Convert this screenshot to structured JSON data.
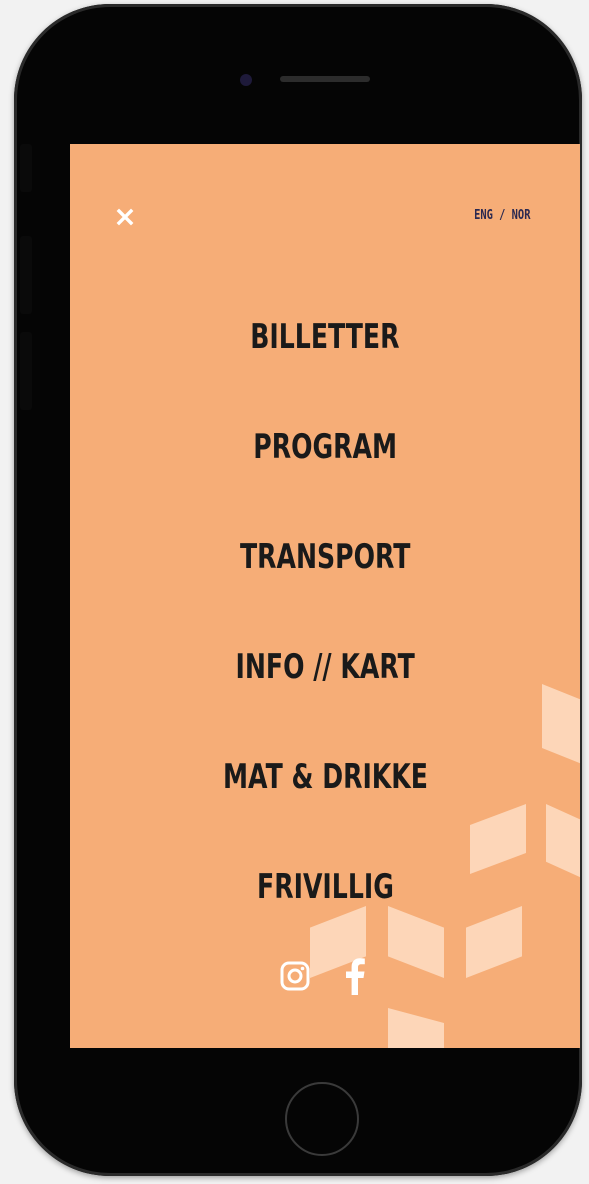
{
  "colors": {
    "screen_background": "#f6ad77",
    "menu_text": "#1a1a1a",
    "lang_text": "#2b2950",
    "icon_white": "#ffffff",
    "device_body": "#050505"
  },
  "header": {
    "close_icon": "close-icon",
    "language": {
      "eng": "ENG",
      "separator": " / ",
      "nor": "NOR"
    }
  },
  "menu": {
    "items": [
      {
        "label": "BILLETTER"
      },
      {
        "label": "PROGRAM"
      },
      {
        "label": "TRANSPORT"
      },
      {
        "label": "INFO // KART"
      },
      {
        "label": "MAT & DRIKKE"
      },
      {
        "label": "FRIVILLIG"
      }
    ]
  },
  "social": {
    "icons": [
      "instagram-icon",
      "facebook-icon"
    ]
  }
}
